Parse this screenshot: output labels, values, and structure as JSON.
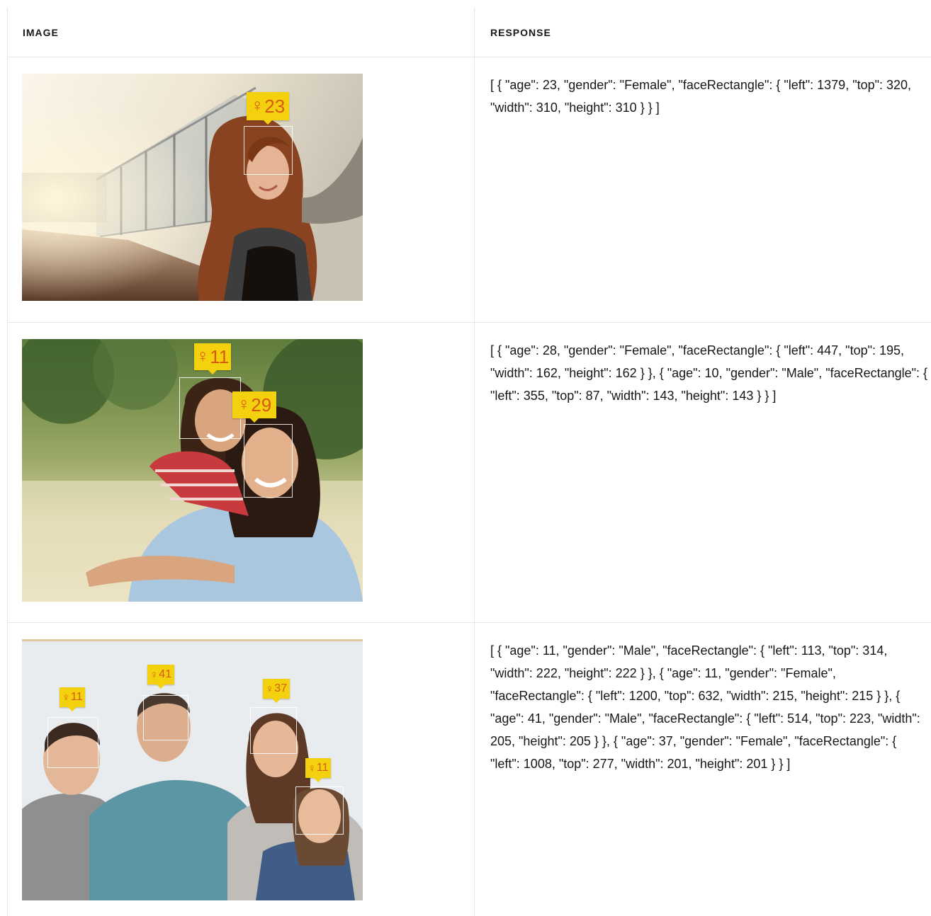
{
  "table": {
    "headers": {
      "image": "IMAGE",
      "response": "RESPONSE"
    },
    "rows": [
      {
        "response": "[ { \"age\": 23, \"gender\": \"Female\", \"faceRectangle\": { \"left\": 1379, \"top\": 320, \"width\": 310, \"height\": 310 } } ]",
        "image": {
          "name": "woman-on-bridge-photo",
          "tags": [
            {
              "icon": "person-icon",
              "age": "23"
            }
          ]
        }
      },
      {
        "response": "[ { \"age\": 28, \"gender\": \"Female\", \"faceRectangle\": { \"left\": 447, \"top\": 195, \"width\": 162, \"height\": 162 } }, { \"age\": 10, \"gender\": \"Male\", \"faceRectangle\": { \"left\": 355, \"top\": 87, \"width\": 143, \"height\": 143 } } ]",
        "image": {
          "name": "mother-daughter-photo",
          "tags": [
            {
              "icon": "person-icon",
              "age": "11"
            },
            {
              "icon": "person-icon",
              "age": "29"
            }
          ]
        }
      },
      {
        "response": "[ { \"age\": 11, \"gender\": \"Male\", \"faceRectangle\": { \"left\": 113, \"top\": 314, \"width\": 222, \"height\": 222 } }, { \"age\": 11, \"gender\": \"Female\", \"faceRectangle\": { \"left\": 1200, \"top\": 632, \"width\": 215, \"height\": 215 } }, { \"age\": 41, \"gender\": \"Male\", \"faceRectangle\": { \"left\": 514, \"top\": 223, \"width\": 205, \"height\": 205 } }, { \"age\": 37, \"gender\": \"Female\", \"faceRectangle\": { \"left\": 1008, \"top\": 277, \"width\": 201, \"height\": 201 } } ]",
        "image": {
          "name": "family-photo",
          "tags": [
            {
              "icon": "person-icon",
              "age": "11"
            },
            {
              "icon": "person-icon",
              "age": "41"
            },
            {
              "icon": "person-icon",
              "age": "37"
            },
            {
              "icon": "person-icon",
              "age": "11"
            }
          ]
        }
      }
    ]
  },
  "colors": {
    "tag_background": "#f4d10f",
    "tag_text": "#d85a10",
    "divider": "#e6e6e6"
  }
}
